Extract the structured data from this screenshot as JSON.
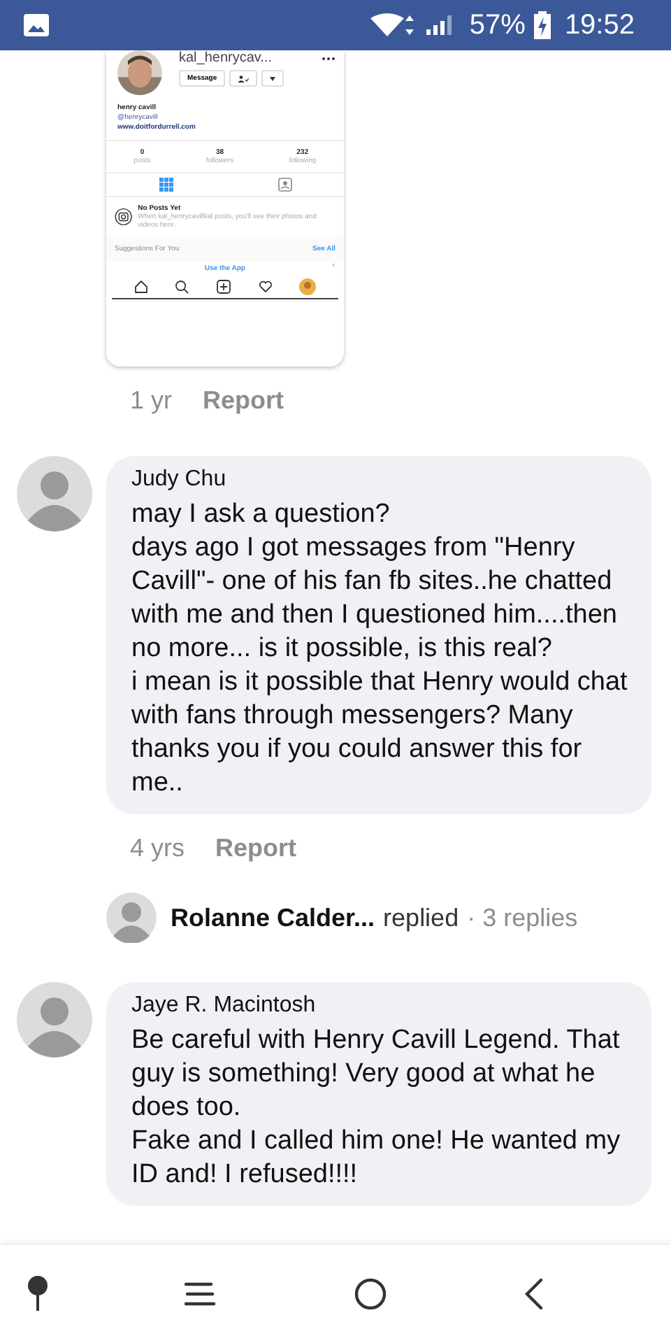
{
  "status_bar": {
    "battery": "57%",
    "time": "19:52"
  },
  "shared_screenshot": {
    "username": "kal_henrycav...",
    "message_button": "Message",
    "name": "henry cavill",
    "handle": "@henrycavill",
    "website": "www.doitfordurrell.com",
    "stats": [
      {
        "value": "0",
        "label": "posts"
      },
      {
        "value": "38",
        "label": "followers"
      },
      {
        "value": "232",
        "label": "following"
      }
    ],
    "empty_title": "No Posts Yet",
    "empty_text": "When kal_henrycavillkal posts, you'll see their photos and videos here.",
    "suggestions": "Suggestions For You",
    "see_all": "See All",
    "use_app": "Use the App",
    "close": "×"
  },
  "comments": [
    {
      "kind": "meta",
      "time": "1 yr",
      "action": "Report"
    },
    {
      "kind": "comment",
      "author": "Judy Chu",
      "text": "may I ask a question?\ndays ago I got messages from \"Henry Cavill\"- one of his fan fb sites..he chatted with me and then I questioned him....then no more... is it possible, is this real?\ni mean is it possible that Henry would chat with fans through messengers? Many thanks you if you could answer this for me.."
    },
    {
      "kind": "meta",
      "time": "4 yrs",
      "action": "Report"
    },
    {
      "kind": "replies",
      "author": "Rolanne Calder...",
      "verb": "replied",
      "count": "· 3 replies"
    },
    {
      "kind": "comment",
      "author": "Jaye R. Macintosh",
      "text": "Be careful with Henry Cavill Legend. That guy is something! Very good at what he does too.\nFake and I called him one! He wanted my ID and! I refused!!!!"
    }
  ]
}
